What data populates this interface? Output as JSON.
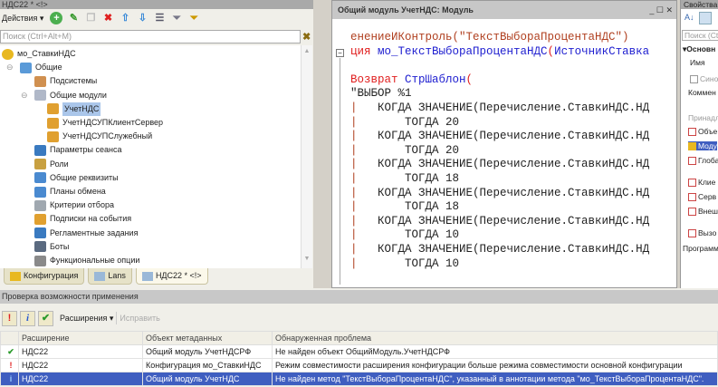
{
  "left_panel": {
    "title": "НДС22 * <!>",
    "actions_label": "Действия ▾",
    "search_placeholder": "Поиск (Ctrl+Alt+M)",
    "tree": [
      {
        "label": "мо_СтавкиНДС",
        "level": 0,
        "icon": "config-icon",
        "color": "#e8b820"
      },
      {
        "label": "Общие",
        "level": 1,
        "icon": "common-icon",
        "color": "#5a9ad8",
        "expander": "⊖"
      },
      {
        "label": "Подсистемы",
        "level": 2,
        "icon": "subsystems-icon",
        "color": "#d09050"
      },
      {
        "label": "Общие модули",
        "level": 2,
        "icon": "modules-icon",
        "color": "#b0b8c8",
        "expander": "⊖"
      },
      {
        "label": "УчетНДС",
        "level": 3,
        "icon": "module-icon",
        "color": "#e0a030",
        "selected": true
      },
      {
        "label": "УчетНДСУПКлиентСервер",
        "level": 3,
        "icon": "module-icon",
        "color": "#e0a030"
      },
      {
        "label": "УчетНДСУПСлужебный",
        "level": 3,
        "icon": "module-icon",
        "color": "#e0a030"
      },
      {
        "label": "Параметры сеанса",
        "level": 2,
        "icon": "session-params-icon",
        "color": "#3a7ac0"
      },
      {
        "label": "Роли",
        "level": 2,
        "icon": "roles-icon",
        "color": "#c8a040"
      },
      {
        "label": "Общие реквизиты",
        "level": 2,
        "icon": "attributes-icon",
        "color": "#4a8ad0"
      },
      {
        "label": "Планы обмена",
        "level": 2,
        "icon": "exchange-plans-icon",
        "color": "#4a8ad0"
      },
      {
        "label": "Критерии отбора",
        "level": 2,
        "icon": "filter-criteria-icon",
        "color": "#a0a8b0"
      },
      {
        "label": "Подписки на события",
        "level": 2,
        "icon": "event-subscriptions-icon",
        "color": "#e0a030"
      },
      {
        "label": "Регламентные задания",
        "level": 2,
        "icon": "scheduled-jobs-icon",
        "color": "#3a7ac0"
      },
      {
        "label": "Боты",
        "level": 2,
        "icon": "bots-icon",
        "color": "#5a6a80"
      },
      {
        "label": "Функциональные опции",
        "level": 2,
        "icon": "functional-options-icon",
        "color": "#8a8a8a"
      }
    ],
    "tabs": [
      {
        "label": "Конфигурация"
      },
      {
        "label": "Lans"
      },
      {
        "label": "НДС22 * <!>",
        "active": true
      }
    ]
  },
  "editor": {
    "title": "Общий модуль УчетНДС: Модуль",
    "lines": [
      [
        {
          "t": "енениеИКонтроль(\"ТекстВыбораПроцентаНДС\")",
          "c": "#b04020"
        }
      ],
      [
        {
          "t": "ция ",
          "c": "#e02020"
        },
        {
          "t": "мо_ТекстВыбораПроцентаНДС",
          "c": "#2020d0"
        },
        {
          "t": "(",
          "c": "#e02020"
        },
        {
          "t": "ИсточникСтавка",
          "c": "#2020d0"
        }
      ],
      [],
      [
        {
          "t": "Возврат ",
          "c": "#e02020"
        },
        {
          "t": "СтрШаблон",
          "c": "#2020d0"
        },
        {
          "t": "(",
          "c": "#e02020"
        }
      ],
      [
        {
          "t": "\"ВЫБОР %1",
          "c": "#222"
        }
      ],
      [
        {
          "t": "|",
          "c": "#b04020"
        },
        {
          "t": "   КОГДА ЗНАЧЕНИЕ(Перечисление.СтавкиНДС.НД",
          "c": "#222"
        }
      ],
      [
        {
          "t": "|",
          "c": "#b04020"
        },
        {
          "t": "       ТОГДА 20",
          "c": "#222"
        }
      ],
      [
        {
          "t": "|",
          "c": "#b04020"
        },
        {
          "t": "   КОГДА ЗНАЧЕНИЕ(Перечисление.СтавкиНДС.НД",
          "c": "#222"
        }
      ],
      [
        {
          "t": "|",
          "c": "#b04020"
        },
        {
          "t": "       ТОГДА 20",
          "c": "#222"
        }
      ],
      [
        {
          "t": "|",
          "c": "#b04020"
        },
        {
          "t": "   КОГДА ЗНАЧЕНИЕ(Перечисление.СтавкиНДС.НД",
          "c": "#222"
        }
      ],
      [
        {
          "t": "|",
          "c": "#b04020"
        },
        {
          "t": "       ТОГДА 18",
          "c": "#222"
        }
      ],
      [
        {
          "t": "|",
          "c": "#b04020"
        },
        {
          "t": "   КОГДА ЗНАЧЕНИЕ(Перечисление.СтавкиНДС.НД",
          "c": "#222"
        }
      ],
      [
        {
          "t": "|",
          "c": "#b04020"
        },
        {
          "t": "       ТОГДА 18",
          "c": "#222"
        }
      ],
      [
        {
          "t": "|",
          "c": "#b04020"
        },
        {
          "t": "   КОГДА ЗНАЧЕНИЕ(Перечисление.СтавкиНДС.НД",
          "c": "#222"
        }
      ],
      [
        {
          "t": "|",
          "c": "#b04020"
        },
        {
          "t": "       ТОГДА 10",
          "c": "#222"
        }
      ],
      [
        {
          "t": "|",
          "c": "#b04020"
        },
        {
          "t": "   КОГДА ЗНАЧЕНИЕ(Перечисление.СтавкиНДС.НД",
          "c": "#222"
        }
      ],
      [
        {
          "t": "|",
          "c": "#b04020"
        },
        {
          "t": "       ТОГДА 10",
          "c": "#222"
        }
      ]
    ]
  },
  "properties": {
    "title": "Свойства",
    "search": "Поиск (Ct",
    "section": "▾Основн",
    "name_label": "Имя",
    "synonym": "Сино",
    "comment": "Коммен",
    "belongs": "Принадл",
    "checks": [
      "Объе",
      "Моду",
      "Глоба",
      "Клие",
      "Серв",
      "Внеш",
      "Вызо"
    ],
    "program": "Программ"
  },
  "check_panel": {
    "title": "Проверка возможности применения",
    "extensions_btn": "Расширения ▾",
    "fix_btn": "Исправить",
    "columns": [
      "Расширение",
      "Объект метаданных",
      "Обнаруженная проблема"
    ],
    "rows": [
      {
        "status": "ok",
        "ext": "НДС22",
        "object": "Общий модуль УчетНДСРФ",
        "problem": "Не найден объект ОбщийМодуль.УчетНДСРФ"
      },
      {
        "status": "error",
        "ext": "НДС22",
        "object": "Конфигурация мо_СтавкиНДС",
        "problem": "Режим совместимости расширения конфигурации больше режима совместимости основной конфигурации"
      },
      {
        "status": "info",
        "ext": "НДС22",
        "object": "Общий модуль УчетНДС",
        "problem": "Не найден метод \"ТекстВыбораПроцентаНДС\", указанный в аннотации метода \"мо_ТекстВыбораПроцентаНДС\".",
        "selected": true
      }
    ]
  }
}
